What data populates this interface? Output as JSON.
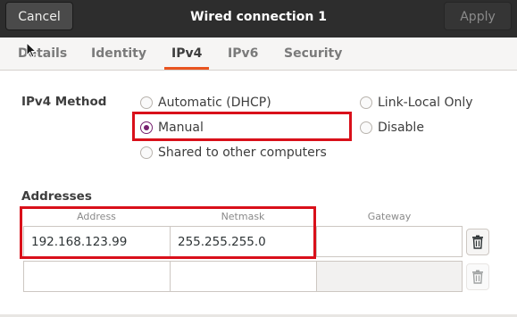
{
  "window": {
    "title": "Wired connection 1",
    "cancel_label": "Cancel",
    "apply_label": "Apply"
  },
  "tabs": [
    {
      "label": "Details"
    },
    {
      "label": "Identity"
    },
    {
      "label": "IPv4",
      "active": true
    },
    {
      "label": "IPv6"
    },
    {
      "label": "Security"
    }
  ],
  "ipv4_method": {
    "label": "IPv4 Method",
    "options": {
      "automatic": "Automatic (DHCP)",
      "manual": "Manual",
      "shared": "Shared to other computers",
      "link_local": "Link-Local Only",
      "disable": "Disable"
    },
    "selected": "Manual"
  },
  "addresses": {
    "label": "Addresses",
    "columns": [
      "Address",
      "Netmask",
      "Gateway"
    ],
    "rows": [
      {
        "address": "192.168.123.99",
        "netmask": "255.255.255.0",
        "gateway": ""
      },
      {
        "address": "",
        "netmask": "",
        "gateway": ""
      }
    ]
  },
  "icons": {
    "delete": "trash-icon",
    "pointer": "mouse-cursor-icon"
  },
  "colors": {
    "header_bg": "#2d2d2d",
    "accent_tab": "#e95420",
    "radio_selected": "#77216f",
    "highlight_box": "#d9101a"
  }
}
